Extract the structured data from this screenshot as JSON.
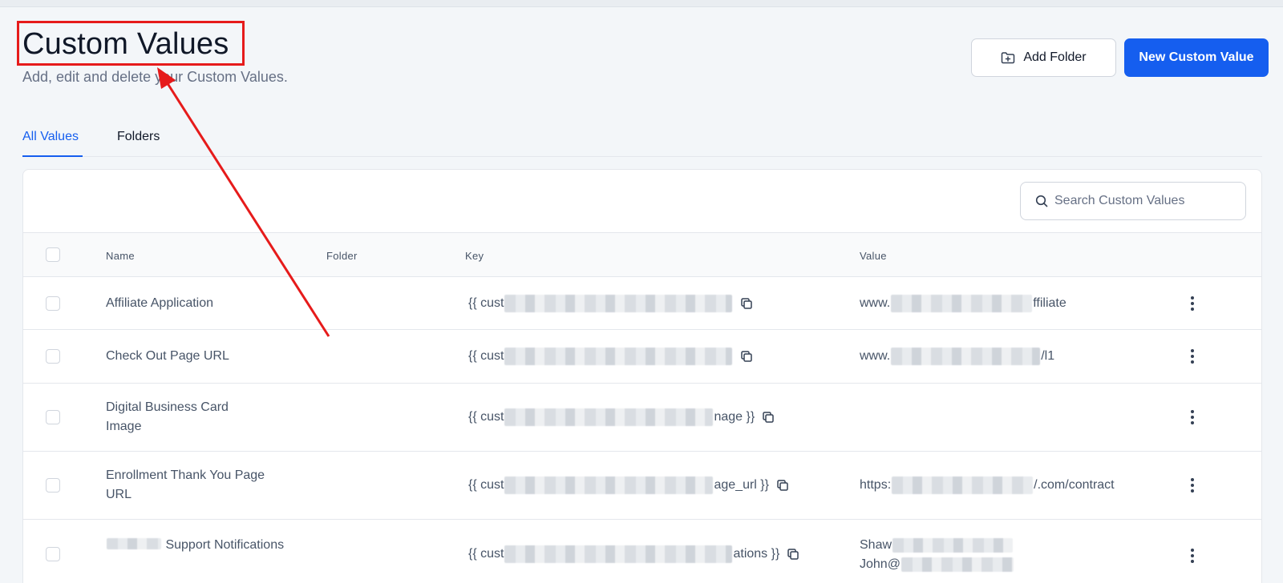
{
  "header": {
    "title": "Custom Values",
    "subtitle": "Add, edit and delete your Custom Values.",
    "add_folder_label": "Add Folder",
    "new_value_label": "New Custom Value"
  },
  "tabs": [
    {
      "label": "All Values",
      "active": true
    },
    {
      "label": "Folders",
      "active": false
    }
  ],
  "search": {
    "placeholder": "Search Custom Values"
  },
  "table": {
    "columns": [
      "Name",
      "Folder",
      "Key",
      "Value"
    ],
    "rows": [
      {
        "name": "Affiliate Application",
        "folder": "",
        "key_prefix": "{{ cust",
        "key_suffix": "}}",
        "value_prefix": "www.",
        "value_suffix": "ffiliate"
      },
      {
        "name": "Check Out Page URL",
        "folder": "",
        "key_prefix": "{{ cust",
        "key_suffix": "}}",
        "value_prefix": "www.",
        "value_suffix": "/l1"
      },
      {
        "name": "Digital Business Card Image",
        "folder": "",
        "key_prefix": "{{ cust",
        "key_suffix": "nage }}",
        "value_prefix": "",
        "value_suffix": ""
      },
      {
        "name": "Enrollment Thank You Page URL",
        "folder": "",
        "key_prefix": "{{ cust",
        "key_suffix": "age_url }}",
        "value_prefix": "https:",
        "value_suffix": "/.com/contract"
      },
      {
        "name": "Support Notifications",
        "folder": "",
        "key_prefix": "{{ cust",
        "key_suffix": "ations }}",
        "value_line1": "Shaw",
        "value_line2": "John@"
      }
    ]
  },
  "colors": {
    "accent": "#155eef",
    "annotation": "#e61b1b"
  }
}
